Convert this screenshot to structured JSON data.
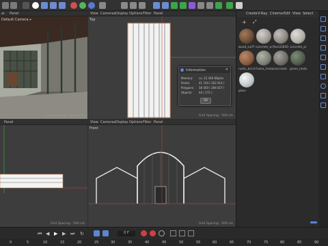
{
  "menus": {
    "left_viewport_top": [
      "View",
      "Cameras",
      "Display",
      "Options",
      "Filter",
      "Panel"
    ],
    "top_left_partial": [
      "al",
      "Panel"
    ],
    "bottom_left_partial": [
      "Panel"
    ],
    "material_manager": [
      "Create",
      "V-Ray",
      "Cinema",
      "Edit",
      "View",
      "Select"
    ]
  },
  "viewports": {
    "perspective": {
      "label": "Default Camera.⌖",
      "grid": "Grid Spacing : 50000 cm"
    },
    "top": {
      "label": "Top",
      "grid": "Grid Spacing : 500 cm"
    },
    "left": {
      "grid": "Grid Spacing : 500 cm"
    },
    "front": {
      "label": "Front",
      "grid": "Grid Spacing : 500 cm"
    }
  },
  "info_dialog": {
    "title": "Information",
    "rows": [
      {
        "label": "Memory:",
        "value": "ca. 21 440 KBytes"
      },
      {
        "label": "Points:",
        "value": "41 744 ( 202 414 )"
      },
      {
        "label": "Polygons:",
        "value": "58 450 ( 284 027 )"
      },
      {
        "label": "Objects:",
        "value": "44 ( 172 )"
      }
    ],
    "ok": "OK"
  },
  "materials": [
    {
      "name": "wood_surf?",
      "color": "#6b4a34"
    },
    {
      "name": "concrete_w",
      "color": "#9b9690"
    },
    {
      "name": "floor22840",
      "color": "#8a857f"
    },
    {
      "name": "concrete_pi",
      "color": "#b0aba5"
    },
    {
      "name": "rustic_brick",
      "color": "#8a5a3c"
    },
    {
      "name": "frame_meta",
      "color": "#7a7f75"
    },
    {
      "name": "concreate",
      "color": "#6f6c68"
    },
    {
      "name": "green_meta",
      "color": "#4e5c4c"
    },
    {
      "name": "glass",
      "color": "#bfc4c8"
    }
  ],
  "timeline": {
    "ticks": [
      "0",
      "5",
      "10",
      "15",
      "20",
      "25",
      "30",
      "35",
      "40",
      "45",
      "50",
      "55",
      "60",
      "65",
      "70",
      "75",
      "80",
      "85",
      "90"
    ],
    "frame": "0 F"
  },
  "colors": {
    "accent": "#5b86d6",
    "ui_bg": "#2e2e2e",
    "viewport": "#3d3d3d",
    "orange": "#e0a070"
  }
}
